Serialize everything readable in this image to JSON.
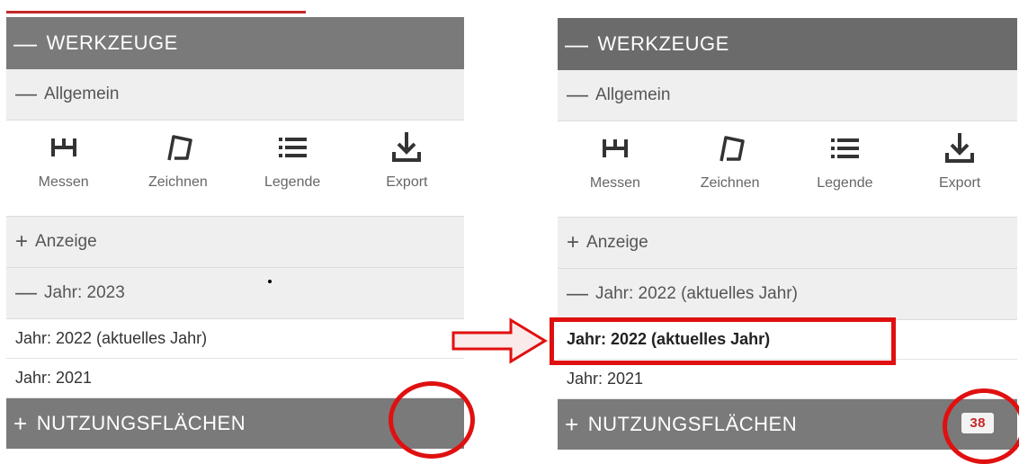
{
  "left": {
    "tools_header": "WERKZEUGE",
    "general_label": "Allgemein",
    "tools": [
      {
        "label": "Messen",
        "icon": "measure-icon"
      },
      {
        "label": "Zeichnen",
        "icon": "draw-icon"
      },
      {
        "label": "Legende",
        "icon": "legend-icon"
      },
      {
        "label": "Export",
        "icon": "download-icon"
      }
    ],
    "display_label": "Anzeige",
    "year_label": "Jahr: 2023",
    "year_options": [
      "Jahr: 2022 (aktuelles Jahr)",
      "Jahr: 2021"
    ],
    "usage_header": "NUTZUNGSFLÄCHEN"
  },
  "right": {
    "tools_header": "WERKZEUGE",
    "general_label": "Allgemein",
    "tools": [
      {
        "label": "Messen",
        "icon": "measure-icon"
      },
      {
        "label": "Zeichnen",
        "icon": "draw-icon"
      },
      {
        "label": "Legende",
        "icon": "legend-icon"
      },
      {
        "label": "Export",
        "icon": "download-icon"
      }
    ],
    "display_label": "Anzeige",
    "year_label": "Jahr: 2022 (aktuelles Jahr)",
    "year_options": [
      "Jahr: 2022 (aktuelles Jahr)",
      "Jahr: 2021"
    ],
    "usage_header": "NUTZUNGSFLÄCHEN",
    "usage_count": "38"
  },
  "colors": {
    "header_bg": "#7a7a7a",
    "annotation_red": "#e01010",
    "badge_text": "#c62828"
  }
}
